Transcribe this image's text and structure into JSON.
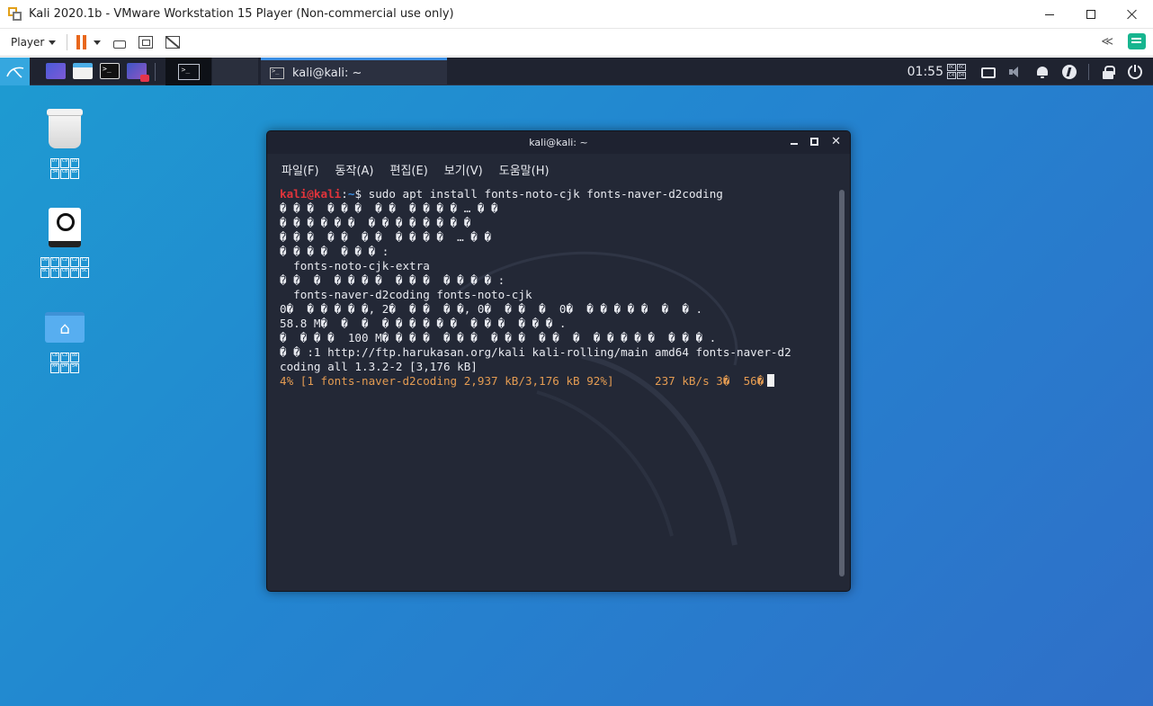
{
  "host": {
    "window_title": "Kali 2020.1b - VMware Workstation 15 Player (Non-commercial use only)",
    "player_menu_label": "Player",
    "collapse_label": "≪"
  },
  "guest": {
    "panel": {
      "clock": "01:55",
      "task_label": "kali@kali: ~",
      "tofu_glyphs": [
        "0C",
        "6C",
        "C4",
        "D4"
      ]
    },
    "desktop_icons": [
      {
        "name": "trash",
        "glyphs": [
          "D7",
          "C9",
          "D3",
          "34",
          "C8",
          "B5"
        ]
      },
      {
        "name": "filesystem",
        "glyphs": [
          "D0",
          "C7",
          "C2",
          "C2",
          "C2",
          "BC",
          "7C",
          "C0",
          "A4",
          "5C"
        ]
      },
      {
        "name": "home",
        "glyphs": [
          "C8",
          "C3",
          "88",
          "A4",
          "D4",
          "54"
        ]
      }
    ]
  },
  "terminal": {
    "title": "kali@kali: ~",
    "menu": [
      "파일(F)",
      "동작(A)",
      "편집(E)",
      "보기(V)",
      "도움말(H)"
    ],
    "prompt_user": "kali@kali",
    "prompt_colon": ":",
    "prompt_path": "~",
    "prompt_dollar": "$ ",
    "command": "sudo apt install fonts-noto-cjk fonts-naver-d2coding",
    "lines": [
      "� � �  � � �  � �  � � � � … � �",
      "� � � � � �  � � � � � � � �",
      "� � �  � �  � �  � � � �  … � �",
      "� � � �  � � � :",
      "  fonts-noto-cjk-extra",
      "� �  �  � � � �  � � �  � � � � :",
      "  fonts-naver-d2coding fonts-noto-cjk",
      "0�  � � � � �, 2�  � �  � �, 0�  � �  �  0�  � � � � �  �  � .",
      "58.8 M�  �  �  � � � � � �  � � �  � � � .",
      "�  � � �  100 M� � � �  � � �  � � �  � �  �  � � � � �  � � � .",
      "� � :1 http://ftp.harukasan.org/kali kali-rolling/main amd64 fonts-naver-d2",
      "coding all 1.3.2-2 [3,176 kB]"
    ],
    "progress": "4% [1 fonts-naver-d2coding 2,937 kB/3,176 kB 92%]      237 kB/s 3�  56�"
  },
  "colors": {
    "desktop_accent": "#2385d0",
    "prompt_user": "#e2343b",
    "prompt_path": "#3b8ee3",
    "progress_text": "#e39b52",
    "pause_orange": "#e8671c",
    "terminal_bg": "#232836"
  },
  "icons": [
    "vmware-logo-icon",
    "pause-icon",
    "send-ctrl-alt-del-icon",
    "fit-guest-icon",
    "unity-icon",
    "notes-icon",
    "kali-menu-icon",
    "lock-icon",
    "power-icon",
    "bell-icon",
    "volume-icon",
    "display-icon"
  ]
}
